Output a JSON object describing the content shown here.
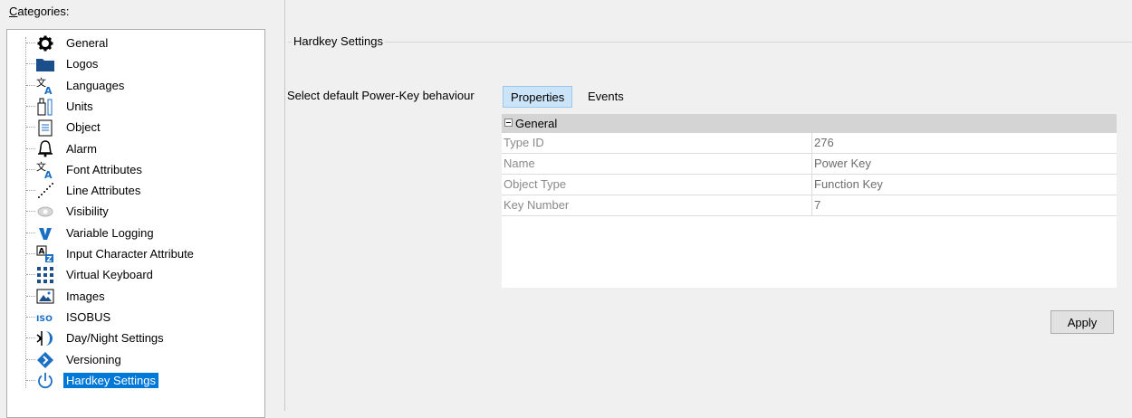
{
  "categories_label": {
    "accel": "C",
    "rest": "ategories:"
  },
  "tree": {
    "items": [
      {
        "label": "General",
        "icon": "gear-icon"
      },
      {
        "label": "Logos",
        "icon": "folder-icon"
      },
      {
        "label": "Languages",
        "icon": "language-icon"
      },
      {
        "label": "Units",
        "icon": "units-icon"
      },
      {
        "label": "Object",
        "icon": "document-icon"
      },
      {
        "label": "Alarm",
        "icon": "bell-icon"
      },
      {
        "label": "Font Attributes",
        "icon": "font-icon"
      },
      {
        "label": "Line Attributes",
        "icon": "dotted-line-icon"
      },
      {
        "label": "Visibility",
        "icon": "eye-icon"
      },
      {
        "label": "Variable Logging",
        "icon": "v-logging-icon"
      },
      {
        "label": "Input Character Attribute",
        "icon": "input-char-icon"
      },
      {
        "label": "Virtual Keyboard",
        "icon": "keyboard-icon"
      },
      {
        "label": "Images",
        "icon": "image-icon"
      },
      {
        "label": "ISOBUS",
        "icon": "iso-icon"
      },
      {
        "label": "Day/Night Settings",
        "icon": "day-night-icon"
      },
      {
        "label": "Versioning",
        "icon": "versioning-icon"
      },
      {
        "label": "Hardkey Settings",
        "icon": "power-icon",
        "selected": true
      }
    ]
  },
  "group": {
    "title": "Hardkey Settings"
  },
  "default_label": "Select default Power-Key behaviour",
  "tabs": [
    {
      "label": "Properties",
      "active": true
    },
    {
      "label": "Events"
    }
  ],
  "grid": {
    "section": "General",
    "rows": [
      {
        "key": "Type ID",
        "value": "276"
      },
      {
        "key": "Name",
        "value": "Power Key"
      },
      {
        "key": "Object Type",
        "value": "Function Key"
      },
      {
        "key": "Key Number",
        "value": "7"
      }
    ]
  },
  "apply_label": "Apply",
  "colors": {
    "selection": "#0078d7",
    "tab_active": "#cce4f7",
    "iso_blue": "#1a6fc4"
  }
}
